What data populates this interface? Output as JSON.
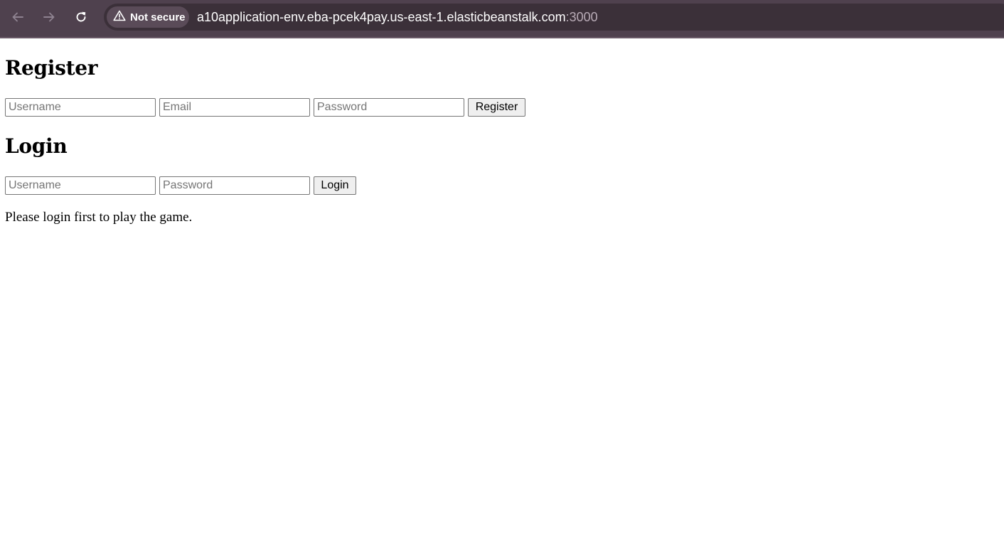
{
  "browser": {
    "security_label": "Not secure",
    "url_host": "a10application-env.eba-pcek4pay.us-east-1.elasticbeanstalk.com",
    "url_port": ":3000",
    "icons": {
      "back": "arrow-left-icon",
      "forward": "arrow-right-icon",
      "reload": "reload-icon",
      "warning": "warning-triangle-icon"
    },
    "colors": {
      "toolbar": "#4f414e",
      "omnibox": "#3b3039"
    }
  },
  "register": {
    "heading": "Register",
    "username_placeholder": "Username",
    "email_placeholder": "Email",
    "password_placeholder": "Password",
    "button_label": "Register"
  },
  "login": {
    "heading": "Login",
    "username_placeholder": "Username",
    "password_placeholder": "Password",
    "button_label": "Login"
  },
  "status_message": "Please login first to play the game."
}
